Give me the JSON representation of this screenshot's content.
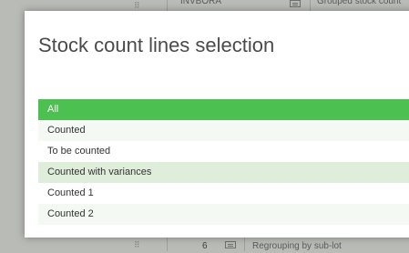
{
  "background": {
    "top_row": {
      "code": "INVBORA",
      "description": "Grouped stock count"
    },
    "bottom_row": {
      "number": "6",
      "description": "Regrouping by sub-lot"
    }
  },
  "dialog": {
    "title": "Stock count lines selection",
    "options": [
      {
        "label": "All",
        "state": "selected"
      },
      {
        "label": "Counted",
        "state": "normal"
      },
      {
        "label": "To be counted",
        "state": "normal"
      },
      {
        "label": "Counted with variances",
        "state": "normal"
      },
      {
        "label": "Counted 1",
        "state": "normal"
      },
      {
        "label": "Counted 2",
        "state": "normal"
      }
    ]
  },
  "colors": {
    "selected": "#4dc052",
    "row_light": "#f4f9f3",
    "row_green": "#dfeedb",
    "overlay": "#b9bbb7"
  }
}
